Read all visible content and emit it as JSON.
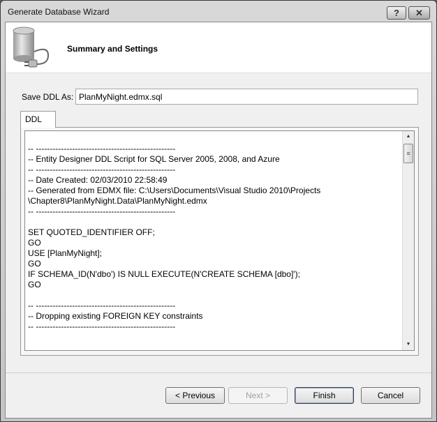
{
  "window": {
    "title": "Generate Database Wizard",
    "help": "?",
    "close": "✕"
  },
  "header": {
    "title": "Summary and Settings",
    "icon": "database-plug-icon"
  },
  "save_ddl": {
    "label": "Save DDL As:",
    "value": "PlanMyNight.edmx.sql"
  },
  "tabs": [
    {
      "label": "DDL"
    }
  ],
  "ddl_lines": [
    "",
    "-- --------------------------------------------------",
    "-- Entity Designer DDL Script for SQL Server 2005, 2008, and Azure",
    "-- --------------------------------------------------",
    "-- Date Created: 02/03/2010 22:58:49",
    "-- Generated from EDMX file: C:\\Users\\Documents\\Visual Studio 2010\\Projects",
    "\\Chapter8\\PlanMyNight.Data\\PlanMyNight.edmx",
    "-- --------------------------------------------------",
    "",
    "SET QUOTED_IDENTIFIER OFF;",
    "GO",
    "USE [PlanMyNight];",
    "GO",
    "IF SCHEMA_ID(N'dbo') IS NULL EXECUTE(N'CREATE SCHEMA [dbo]');",
    "GO",
    "",
    "-- --------------------------------------------------",
    "-- Dropping existing FOREIGN KEY constraints",
    "-- --------------------------------------------------"
  ],
  "buttons": {
    "previous": "< Previous",
    "next": "Next >",
    "finish": "Finish",
    "cancel": "Cancel"
  }
}
